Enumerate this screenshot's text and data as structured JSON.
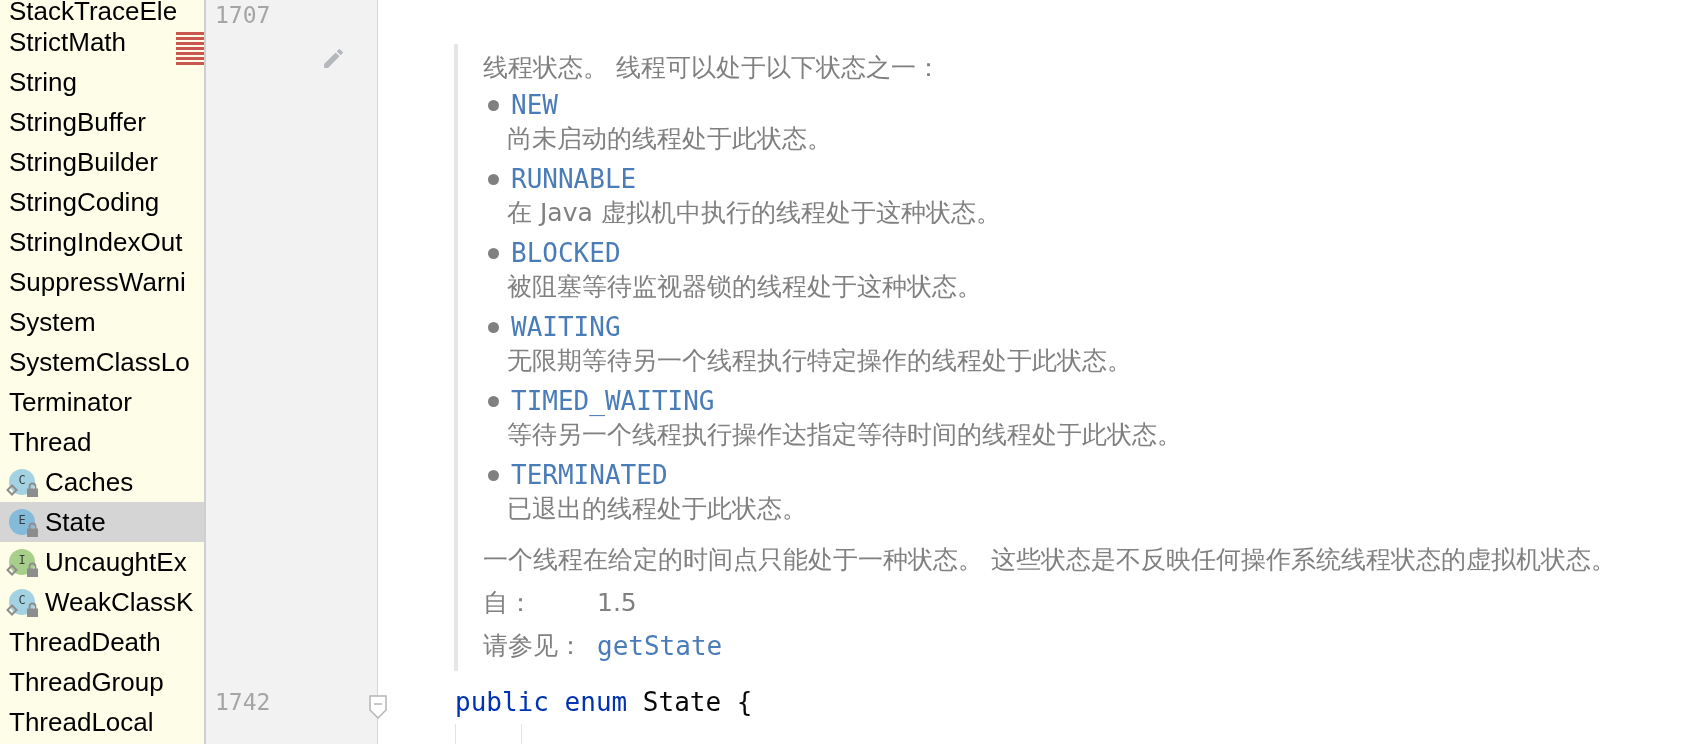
{
  "project_tree": {
    "items": [
      {
        "label": "StackTraceEle",
        "selected": false
      },
      {
        "label": "StrictMath",
        "selected": false
      },
      {
        "label": "String",
        "selected": false
      },
      {
        "label": "StringBuffer",
        "selected": false
      },
      {
        "label": "StringBuilder",
        "selected": false
      },
      {
        "label": "StringCoding",
        "selected": false
      },
      {
        "label": "StringIndexOut",
        "selected": false
      },
      {
        "label": "SuppressWarni",
        "selected": false
      },
      {
        "label": "System",
        "selected": false
      },
      {
        "label": "SystemClassLo",
        "selected": false
      },
      {
        "label": "Terminator",
        "selected": false
      },
      {
        "label": "Thread",
        "selected": false,
        "children": [
          {
            "label": "Caches",
            "icon": "C",
            "kind": "class",
            "static": true,
            "selected": false
          },
          {
            "label": "State",
            "icon": "E",
            "kind": "enum",
            "static": false,
            "selected": true
          },
          {
            "label": "UncaughtEx",
            "icon": "I",
            "kind": "interface",
            "static": true,
            "selected": false
          },
          {
            "label": "WeakClassK",
            "icon": "C",
            "kind": "class",
            "static": true,
            "selected": false
          }
        ]
      },
      {
        "label": "ThreadDeath",
        "selected": false
      },
      {
        "label": "ThreadGroup",
        "selected": false
      },
      {
        "label": "ThreadLocal",
        "selected": false
      }
    ]
  },
  "editor": {
    "blank_line": {
      "line_number": "1707"
    },
    "documentation": {
      "intro": "线程状态。 线程可以处于以下状态之一：",
      "states": [
        {
          "name": "NEW",
          "description": "尚未启动的线程处于此状态。"
        },
        {
          "name": "RUNNABLE",
          "description": "在 Java 虚拟机中执行的线程处于这种状态。"
        },
        {
          "name": "BLOCKED",
          "description": "被阻塞等待监视器锁的线程处于这种状态。"
        },
        {
          "name": "WAITING",
          "description": "无限期等待另一个线程执行特定操作的线程处于此状态。"
        },
        {
          "name": "TIMED_WAITING",
          "description": "等待另一个线程执行操作达指定等待时间的线程处于此状态。"
        },
        {
          "name": "TERMINATED",
          "description": "已退出的线程处于此状态。"
        }
      ],
      "note": "一个线程在给定的时间点只能处于一种状态。 这些状态是不反映任何操作系统线程状态的虚拟机状态。",
      "tags": [
        {
          "label": "自：",
          "value": "1.5",
          "kind": "text"
        },
        {
          "label": "请参见：",
          "value": "getState",
          "kind": "link"
        }
      ]
    },
    "code_line": {
      "line_number": "1742",
      "tokens": [
        {
          "text": "public",
          "kind": "keyword"
        },
        {
          "text": "enum",
          "kind": "keyword"
        },
        {
          "text": "State",
          "kind": "identifier"
        },
        {
          "text": "{",
          "kind": "punctuation"
        }
      ]
    }
  }
}
